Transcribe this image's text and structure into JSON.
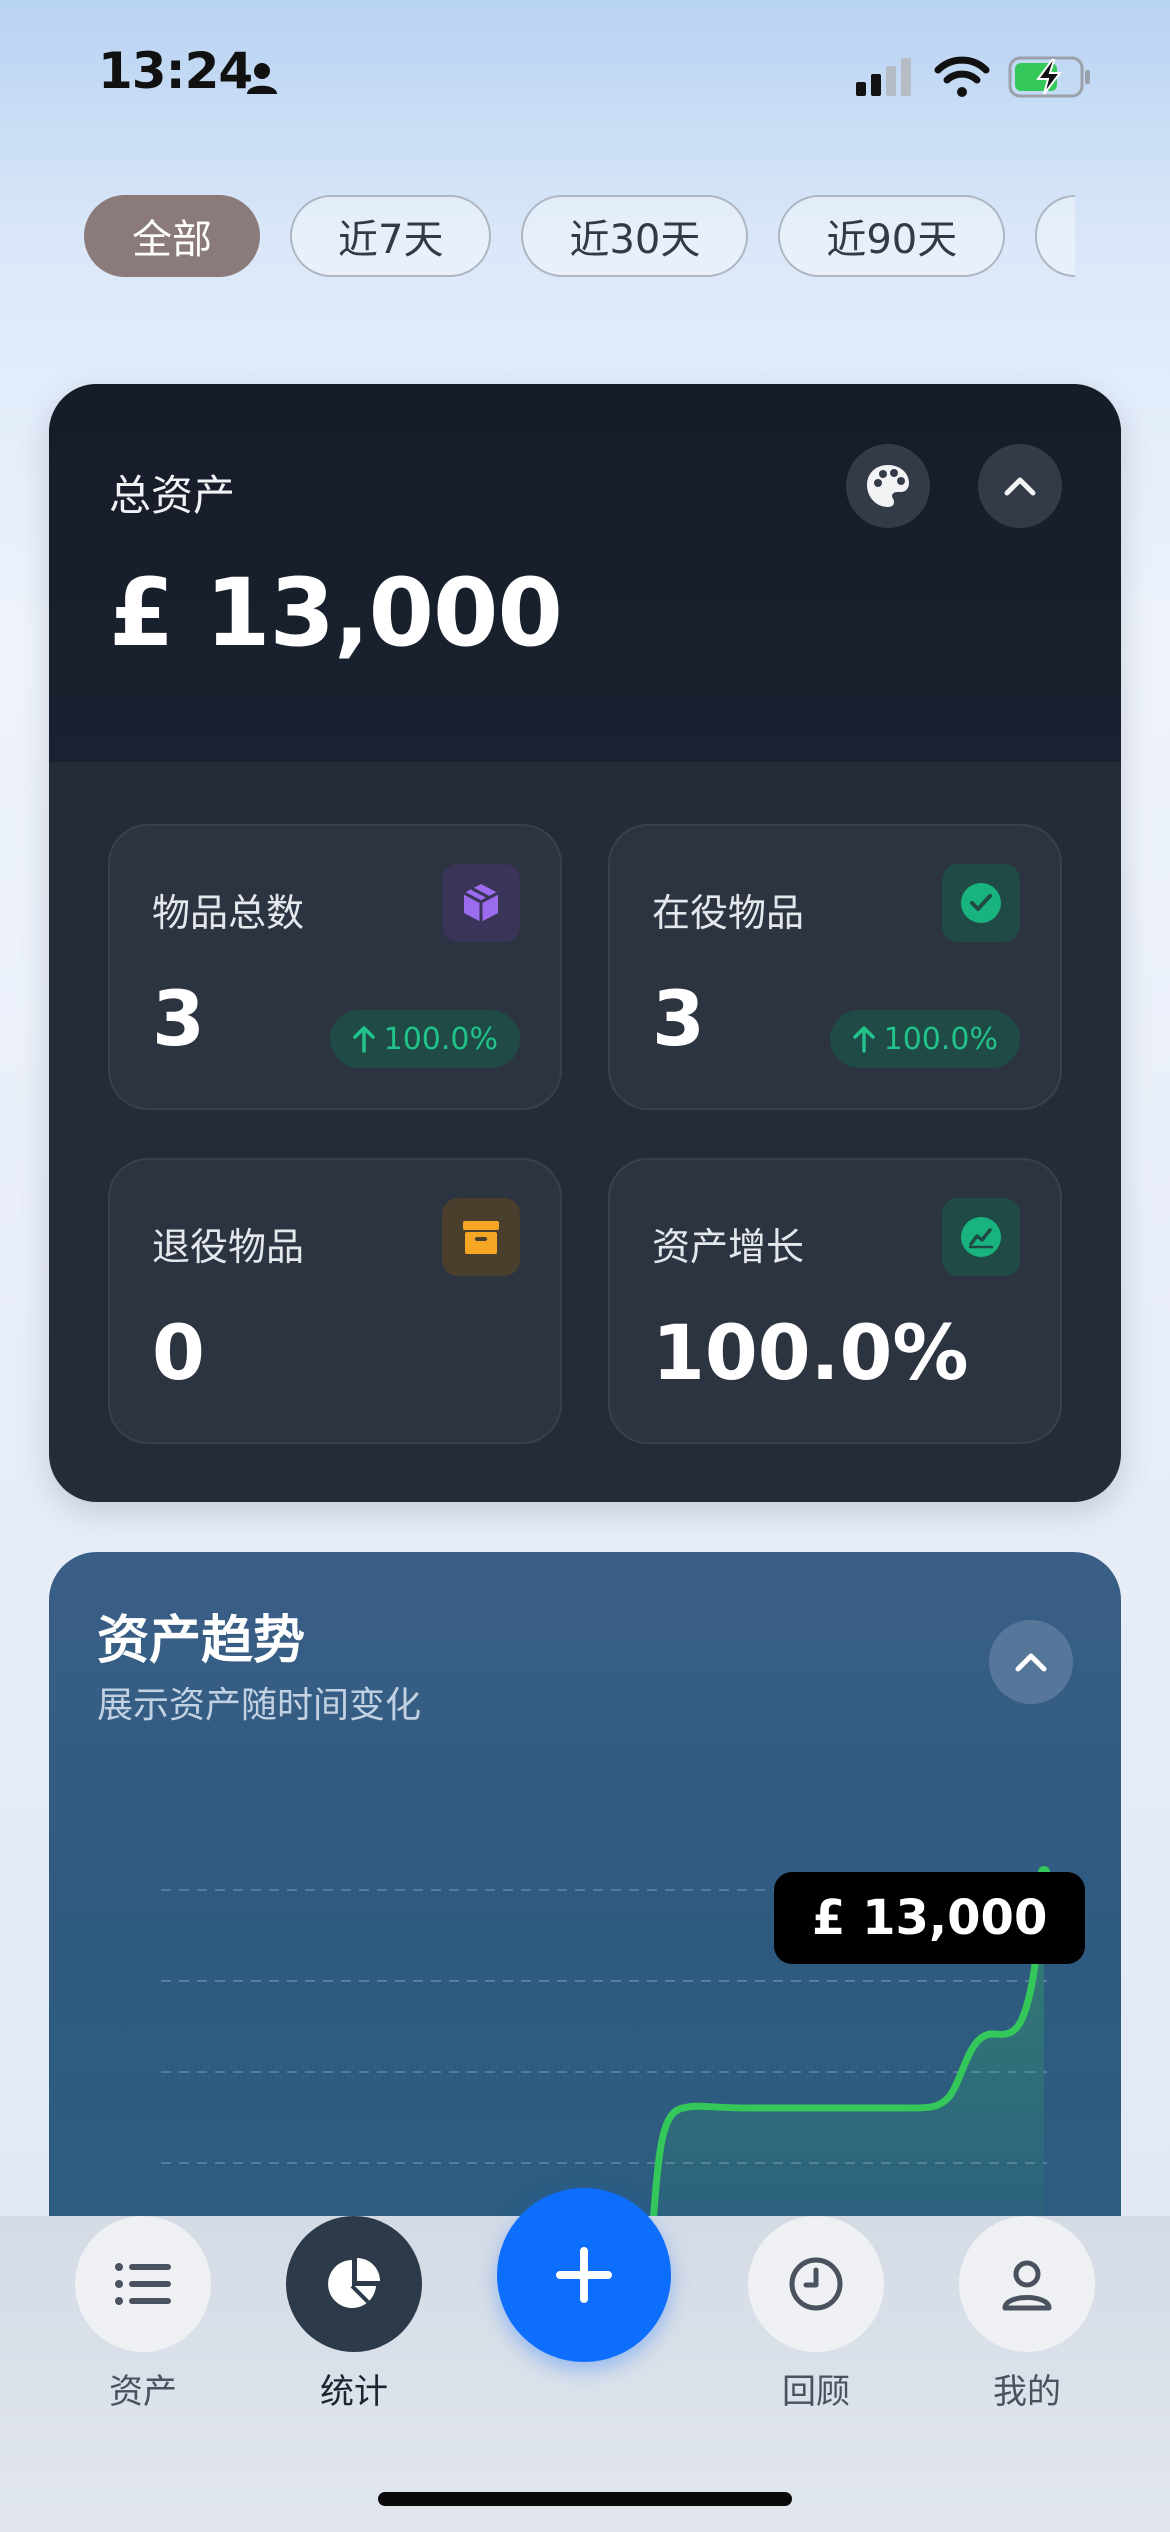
{
  "status_bar": {
    "time": "13:24"
  },
  "filters": [
    {
      "label": "全部",
      "active": true
    },
    {
      "label": "近7天",
      "active": false
    },
    {
      "label": "近30天",
      "active": false
    },
    {
      "label": "近90天",
      "active": false
    }
  ],
  "asset_card": {
    "label": "总资产",
    "value": "£ 13,000",
    "stats": {
      "total_items": {
        "label": "物品总数",
        "value": "3",
        "change": "100.0%",
        "icon": "cube-icon"
      },
      "active_items": {
        "label": "在役物品",
        "value": "3",
        "change": "100.0%",
        "icon": "check-circle-icon"
      },
      "retired_items": {
        "label": "退役物品",
        "value": "0",
        "icon": "archive-box-icon"
      },
      "asset_growth": {
        "label": "资产增长",
        "value": "100.0%",
        "icon": "trend-chart-icon"
      }
    }
  },
  "trend_card": {
    "title": "资产趋势",
    "subtitle": "展示资产随时间变化",
    "tooltip": "£ 13,000"
  },
  "colors": {
    "accent_blue": "#0d6efd",
    "positive_green": "#22c38a",
    "line_green": "#34c759",
    "active_chip": "#8b7a7a"
  },
  "tab_bar": {
    "assets": "资产",
    "stats": "统计",
    "review": "回顾",
    "mine": "我的"
  }
}
